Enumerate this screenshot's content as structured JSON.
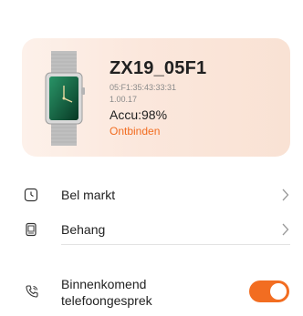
{
  "device": {
    "name": "ZX19_05F1",
    "mac": "05:F1:35:43:33:31",
    "firmware": "1.00.17",
    "battery": "Accu:98%",
    "unbind_label": "Ontbinden"
  },
  "menu": {
    "items": [
      {
        "label": "Bel markt",
        "icon": "watch-face-icon"
      },
      {
        "label": "Behang",
        "icon": "wallpaper-icon"
      }
    ]
  },
  "settings": {
    "incoming_call": {
      "label_line1": "Binnenkomend",
      "label_line2": "telefoongesprek",
      "icon": "phone-incoming-icon",
      "enabled": true
    }
  },
  "colors": {
    "accent": "#f26d21",
    "card_bg": "#fbe7dc"
  }
}
